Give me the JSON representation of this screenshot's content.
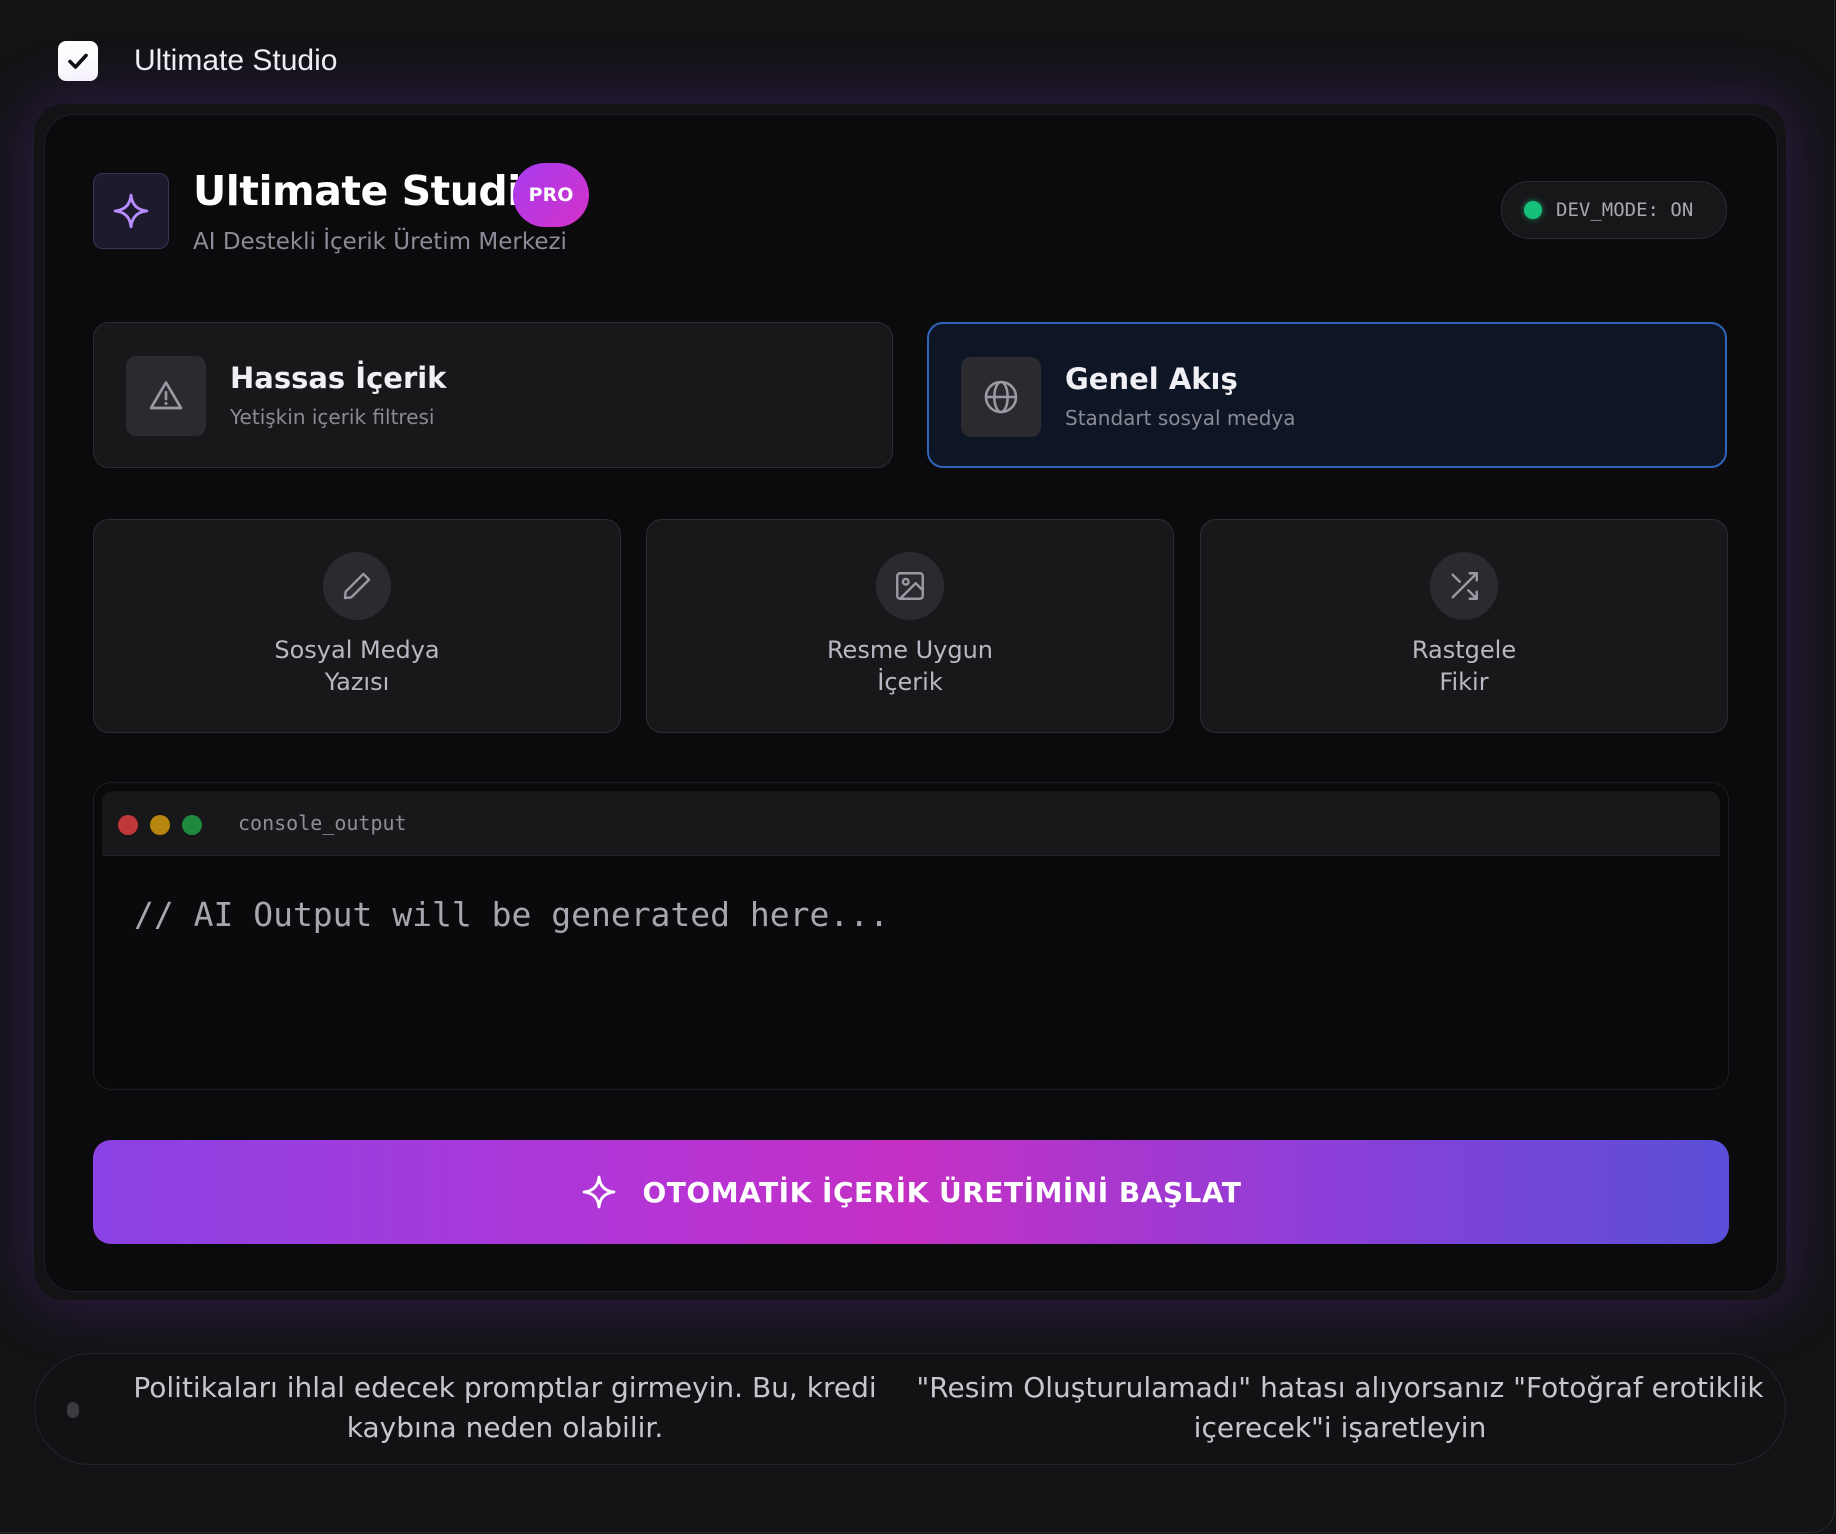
{
  "topbar": {
    "title": "Ultimate Studio"
  },
  "header": {
    "title": "Ultimate Studio",
    "badge": "PRO",
    "subtitle": "AI Destekli İçerik Üretim Merkezi",
    "dev_mode": "DEV_MODE: ON"
  },
  "modes": [
    {
      "title": "Hassas İçerik",
      "subtitle": "Yetişkin içerik filtresi",
      "icon": "warning-triangle-icon",
      "active": false
    },
    {
      "title": "Genel Akış",
      "subtitle": "Standart sosyal medya",
      "icon": "globe-icon",
      "active": true
    }
  ],
  "actions": [
    {
      "label": "Sosyal Medya\nYazısı",
      "icon": "pencil-icon"
    },
    {
      "label": "Resme Uygun\nİçerik",
      "icon": "image-icon"
    },
    {
      "label": "Rastgele\nFikir",
      "icon": "shuffle-icon"
    }
  ],
  "console": {
    "name": "console_output",
    "placeholder": "// AI Output will be generated here..."
  },
  "cta": {
    "label": "OTOMATİK İÇERİK ÜRETİMİNİ BAŞLAT"
  },
  "notices": [
    "Politikaları ihlal edecek promptlar girmeyin. Bu, kredi kaybına neden olabilir.",
    "\"Resim Oluşturulamadı\" hatası alıyorsanız \"Fotoğraf erotiklik içerecek\"i işaretleyin"
  ],
  "colors": {
    "accent_purple": "#a63cf0",
    "accent_pink": "#d531c8",
    "active_border": "#2f64b8",
    "status_green": "#16c07a"
  }
}
